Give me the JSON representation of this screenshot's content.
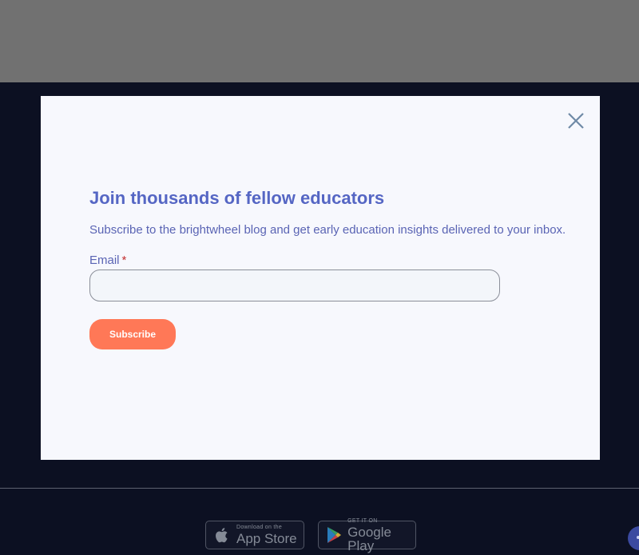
{
  "modal": {
    "title": "Join thousands of fellow educators",
    "subtitle": "Subscribe to the brightwheel blog and get early education insights delivered to your inbox.",
    "email_label": "Email",
    "required_marker": "*",
    "email_value": "",
    "email_placeholder": "",
    "subscribe_label": "Subscribe",
    "close_icon": "close-icon"
  },
  "footer": {
    "app_store": {
      "small": "Download on the",
      "big": "App Store",
      "icon": "apple-icon"
    },
    "google_play": {
      "small": "GET IT ON",
      "big": "Google Play",
      "icon": "google-play-icon"
    }
  },
  "colors": {
    "overlay_top": "#717171",
    "page_background": "#0c1022",
    "modal_background": "#f7f8fd",
    "heading": "#5566c4",
    "text": "#5a64b4",
    "required": "#c33131",
    "button": "#ff7857",
    "close_icon": "#6f8aa6"
  }
}
